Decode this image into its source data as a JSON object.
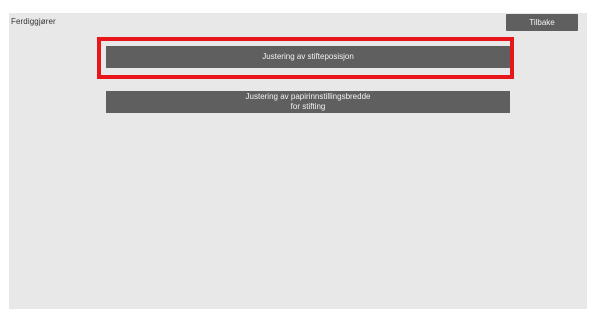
{
  "header": {
    "title": "Ferdiggjører",
    "back_label": "Tilbake"
  },
  "menu": {
    "items": [
      {
        "label": "Justering av stifteposisjon"
      },
      {
        "label": "Justering av papirinnstillingsbredde\nfor stifting"
      }
    ]
  },
  "annotation": {
    "highlight_color": "#e8151b"
  }
}
